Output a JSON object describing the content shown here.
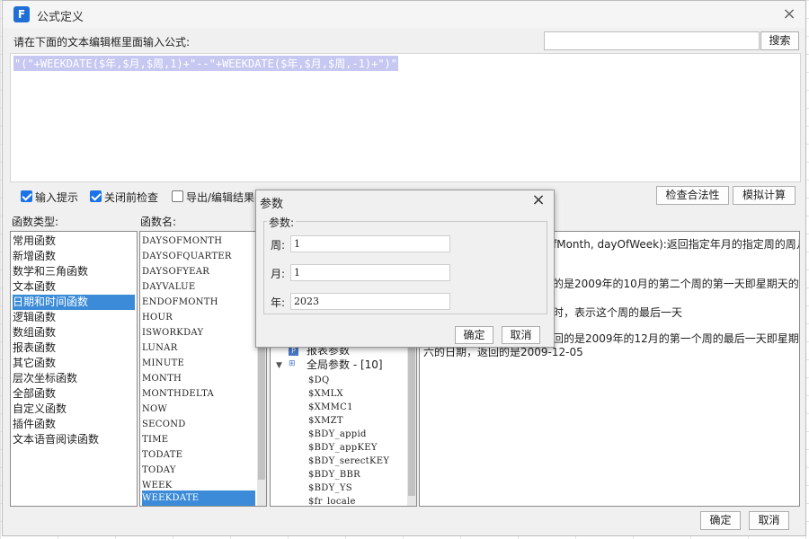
{
  "dialog": {
    "title": "公式定义",
    "logo": "F",
    "close_icon": "×",
    "prompt": "请在下面的文本编辑框里面输入公式:",
    "search_placeholder": "",
    "search_button": "搜索",
    "formula": "\"(\"+WEEKDATE($年,$月,$周,1)+\"--\"+WEEKDATE($年,$月,$周,-1)+\")\""
  },
  "options": {
    "input_hint": {
      "label": "输入提示",
      "checked": true
    },
    "check_on_close": {
      "label": "关闭前检查",
      "checked": true
    },
    "export_result": {
      "label": "导出/编辑结果",
      "checked": false
    },
    "check_validity": "检查合法性",
    "simulate": "模拟计算"
  },
  "function_types": {
    "header": "函数类型:",
    "items": [
      "常用函数",
      "新增函数",
      "数学和三角函数",
      "文本函数",
      "日期和时间函数",
      "逻辑函数",
      "数组函数",
      "报表函数",
      "其它函数",
      "层次坐标函数",
      "全部函数",
      "自定义函数",
      "插件函数",
      "文本语音阅读函数"
    ],
    "selected": "日期和时间函数"
  },
  "function_names": {
    "header": "函数名:",
    "items": [
      "DAYSOFMONTH",
      "DAYSOFQUARTER",
      "DAYSOFYEAR",
      "DAYVALUE",
      "ENDOFMONTH",
      "HOUR",
      "ISWORKDAY",
      "LUNAR",
      "MINUTE",
      "MONTH",
      "MONTHDELTA",
      "NOW",
      "SECOND",
      "TIME",
      "TODATE",
      "TODAY",
      "WEEK",
      "WEEKDATE"
    ],
    "selected": "WEEKDATE"
  },
  "params_tree": {
    "report_params": "报表参数",
    "global_params": "全局参数 - [10]",
    "items": [
      "$DQ",
      "$XMLX",
      "$XMMC1",
      "$XMZT",
      "$BDY_appid",
      "$BDY_appKEY",
      "$BDY_serectKEY",
      "$BDY_BBR",
      "$BDY_YS",
      "$fr_locale"
    ]
  },
  "description": {
    "line1": "fMonth, dayOfWeek):返回指定年月的指定周的周几",
    "line2": "的是2009年的10月的第二个周的第一天即星期天的",
    "line3": "时，表示这个周的最后一天",
    "line4": "回的是2009年的12月的第一个周的最后一天即星期",
    "line5": "六的日期，返回的是2009-12-05"
  },
  "footer": {
    "ok": "确定",
    "cancel": "取消"
  },
  "param_dialog": {
    "title": "参数",
    "close_icon": "×",
    "group_label": "参数:",
    "fields": [
      {
        "label": "周:",
        "value": "1"
      },
      {
        "label": "月:",
        "value": "1"
      },
      {
        "label": "年:",
        "value": "2023"
      }
    ],
    "ok": "确定",
    "cancel": "取消"
  }
}
